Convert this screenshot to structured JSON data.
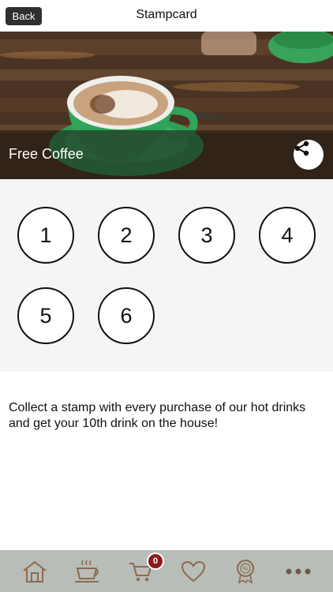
{
  "header": {
    "back_label": "Back",
    "title": "Stampcard"
  },
  "hero": {
    "title": "Free Coffee",
    "share_icon": "share-icon"
  },
  "stamps": [
    {
      "label": "1"
    },
    {
      "label": "2"
    },
    {
      "label": "3"
    },
    {
      "label": "4"
    },
    {
      "label": "5"
    },
    {
      "label": "6"
    }
  ],
  "description": "Collect a stamp with every purchase of our hot drinks and get your 10th drink on the house!",
  "tabbar": {
    "items": [
      {
        "icon": "home-icon"
      },
      {
        "icon": "coffee-cup-icon"
      },
      {
        "icon": "cart-icon"
      },
      {
        "icon": "heart-icon"
      },
      {
        "icon": "award-badge-icon"
      },
      {
        "icon": "more-icon"
      }
    ],
    "cart_badge": "0"
  },
  "colors": {
    "tabbar_bg": "#b9bdb7",
    "tab_icon": "#8a6a4f",
    "badge": "#8b1a1a",
    "stamp_area_bg": "#f5f5f5"
  }
}
